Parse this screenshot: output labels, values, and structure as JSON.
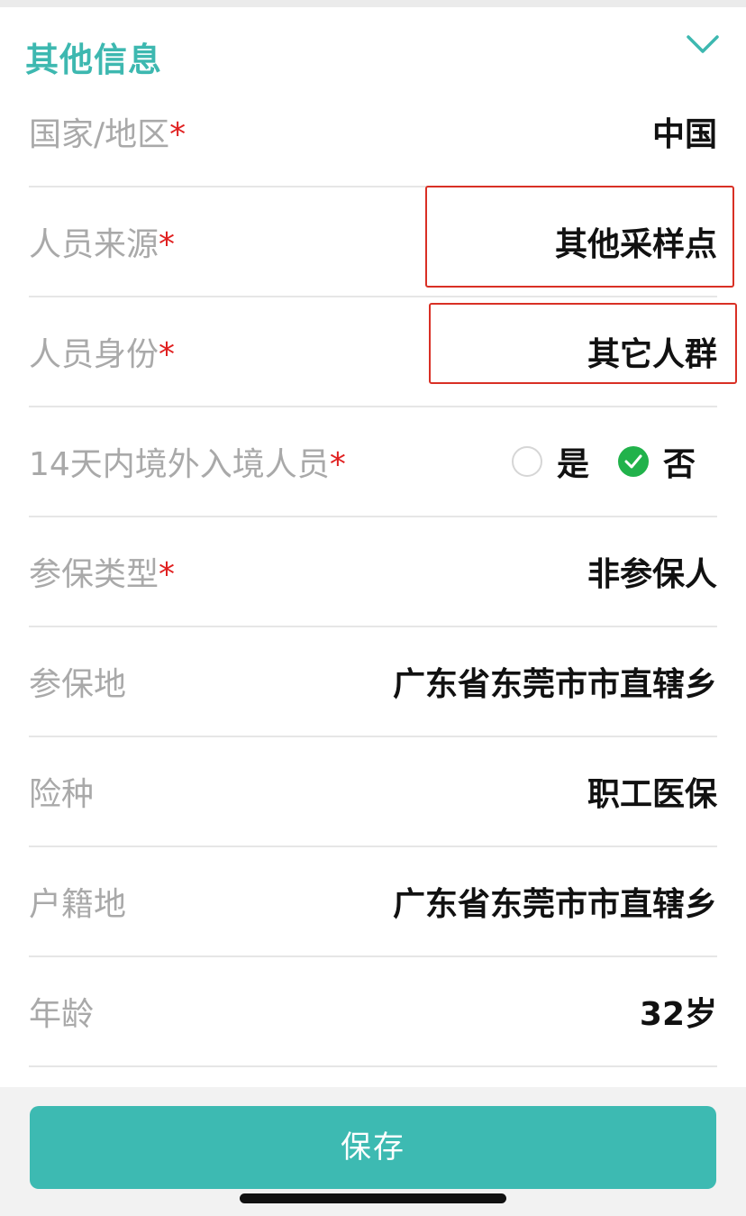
{
  "section": {
    "title": "其他信息"
  },
  "rows": [
    {
      "label": "国家/地区",
      "required": "*",
      "value": "中国"
    },
    {
      "label": "人员来源",
      "required": "*",
      "value": "其他采样点"
    },
    {
      "label": "人员身份",
      "required": "*",
      "value": "其它人群"
    },
    {
      "label": "14天内境外入境人员",
      "required": "*",
      "options": [
        "是",
        "否"
      ],
      "selected": "否"
    },
    {
      "label": "参保类型",
      "required": "*",
      "value": "非参保人"
    },
    {
      "label": "参保地",
      "required": "",
      "value": "广东省东莞市市直辖乡"
    },
    {
      "label": "险种",
      "required": "",
      "value": "职工医保"
    },
    {
      "label": "户籍地",
      "required": "",
      "value": "广东省东莞市市直辖乡"
    },
    {
      "label": "年龄",
      "required": "",
      "value": "32岁"
    }
  ],
  "footer": {
    "save_label": "保存"
  },
  "colors": {
    "accent": "#3dbab2",
    "required": "#e02020",
    "checked": "#21b24b",
    "highlight": "#d93025"
  },
  "icons": {
    "collapse": "chevron-down-icon",
    "check": "check-icon"
  }
}
